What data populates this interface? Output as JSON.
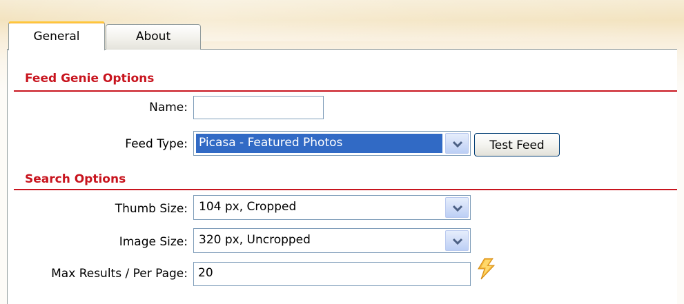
{
  "tabs": [
    {
      "label": "General",
      "active": true
    },
    {
      "label": "About",
      "active": false
    }
  ],
  "sections": {
    "feed_genie": {
      "title": "Feed Genie Options",
      "name_label": "Name:",
      "name_value": "",
      "feed_type_label": "Feed Type:",
      "feed_type_value": "Picasa - Featured Photos",
      "test_feed_label": "Test Feed"
    },
    "search": {
      "title": "Search Options",
      "thumb_size_label": "Thumb Size:",
      "thumb_size_value": "104 px, Cropped",
      "image_size_label": "Image Size:",
      "image_size_value": "320 px, Uncropped",
      "max_results_label": "Max Results / Per Page:",
      "max_results_value": "20"
    }
  },
  "colors": {
    "section_title": "#c8141e",
    "active_tab_accent": "#f6b23c",
    "selection_highlight": "#316ac5",
    "field_border": "#7f9db9"
  },
  "icons": {
    "dropdown_arrow": "chevron-down-icon",
    "bolt": "lightning-bolt-icon"
  }
}
